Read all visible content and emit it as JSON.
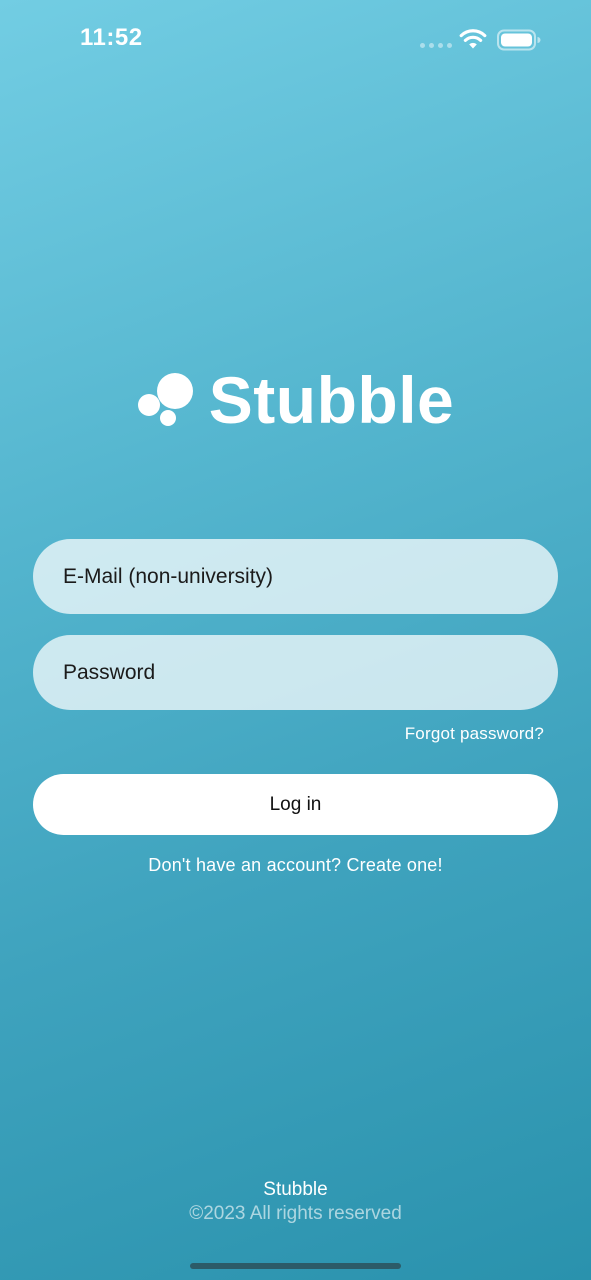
{
  "status_bar": {
    "time": "11:52"
  },
  "app": {
    "name": "Stubble"
  },
  "login_form": {
    "email_placeholder": "E-Mail (non-university)",
    "password_placeholder": "Password",
    "forgot_password_label": "Forgot password?",
    "login_button_label": "Log in",
    "signup_link_label": "Don't have an account? Create one!"
  },
  "footer": {
    "name": "Stubble",
    "copyright": "©2023 All rights reserved"
  },
  "colors": {
    "background_top": "#72cde3",
    "background_bottom": "#2a92ad",
    "field_background": "#dcf0f5",
    "button_background": "#ffffff"
  },
  "icons": [
    "cellular-signal-icon",
    "wifi-icon",
    "battery-icon",
    "stubble-logo-icon"
  ]
}
